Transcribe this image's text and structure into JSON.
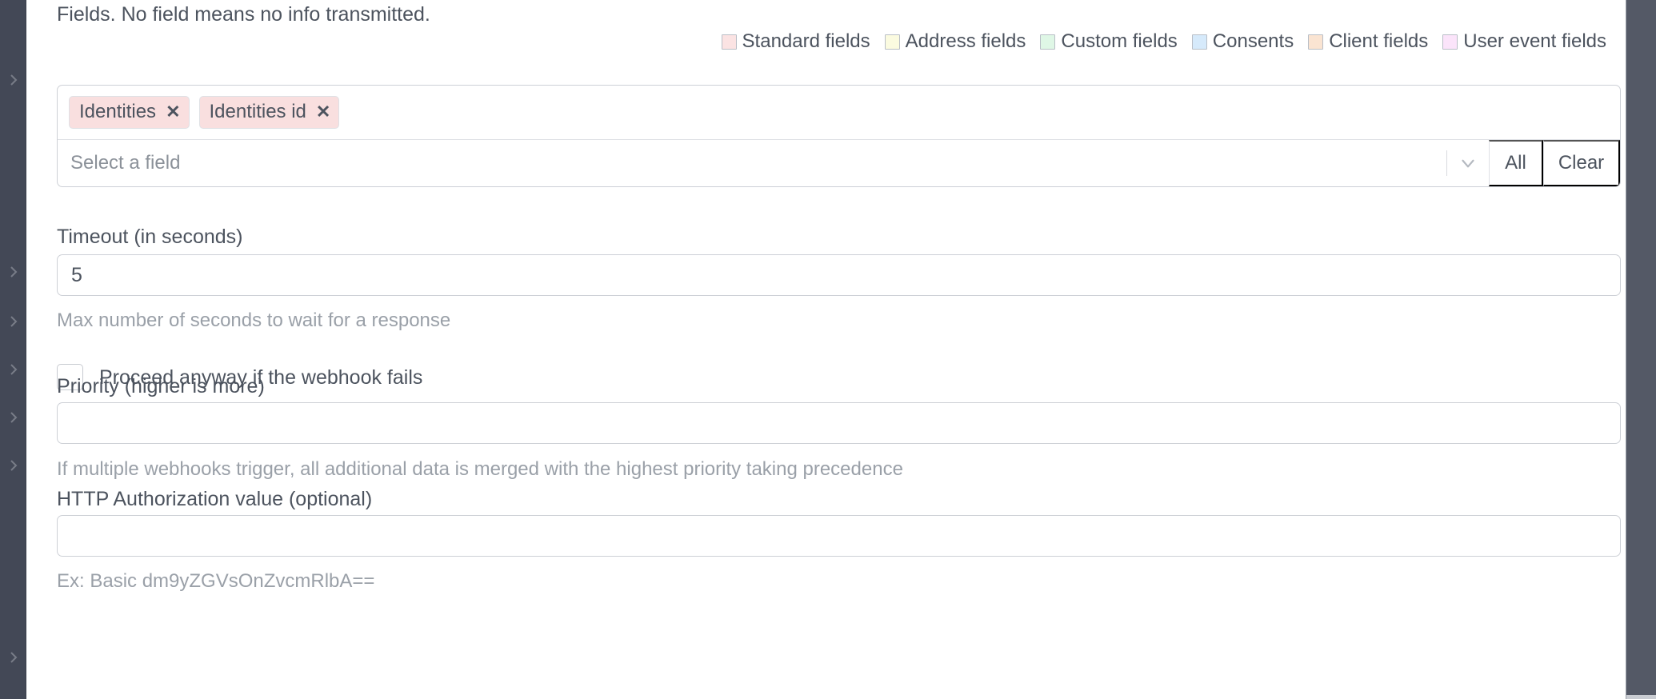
{
  "intro": {
    "text": "Fields. No field means no info transmitted."
  },
  "legend": {
    "items": [
      {
        "label": "Standard fields",
        "color": "#fbe3e3"
      },
      {
        "label": "Address fields",
        "color": "#fbfbe0"
      },
      {
        "label": "Custom fields",
        "color": "#dff7e6"
      },
      {
        "label": "Consents",
        "color": "#d6eafb"
      },
      {
        "label": "Client fields",
        "color": "#fae4d2"
      },
      {
        "label": "User event fields",
        "color": "#fbe4fa"
      }
    ]
  },
  "field_selector": {
    "tags": [
      {
        "label": "Identities",
        "remove_icon": "close-icon"
      },
      {
        "label": "Identities id",
        "remove_icon": "close-icon"
      }
    ],
    "placeholder": "Select a field",
    "value": "",
    "chevron_icon": "chevron-down-icon",
    "all_label": "All",
    "clear_label": "Clear"
  },
  "timeout": {
    "label": "Timeout (in seconds)",
    "value": "5",
    "placeholder": "",
    "help": "Max number of seconds to wait for a response"
  },
  "proceed_anyway": {
    "label": "Proceed anyway if the webhook fails",
    "checked": false
  },
  "priority": {
    "label": "Priority (higher is more)",
    "value": "",
    "placeholder": "",
    "help": "If multiple webhooks trigger, all additional data is merged with the highest priority taking precedence"
  },
  "authorization": {
    "label": "HTTP Authorization value (optional)",
    "value": "",
    "placeholder": "",
    "help": "Ex: Basic dm9yZGVsOnZvcmRlbA=="
  },
  "rails": {
    "left_icon": "chevron-right-icon",
    "left_color": "#434856",
    "right_color": "#545966"
  }
}
